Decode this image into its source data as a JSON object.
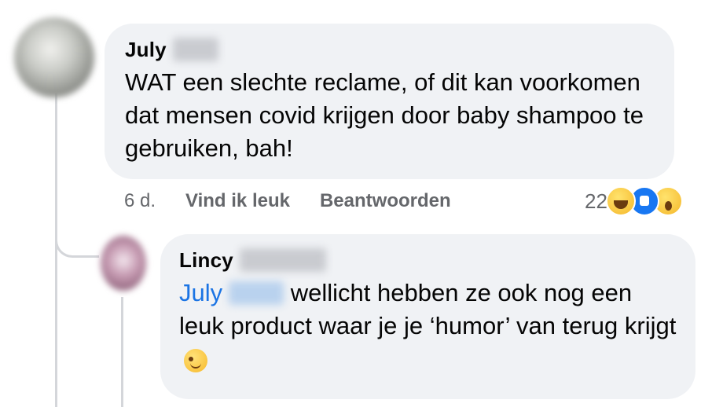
{
  "comment": {
    "author": "July",
    "text": "WAT een slechte reclame, of dit kan voorkomen dat mensen covid krijgen door baby shampoo te gebruiken, bah!",
    "time": "6 d.",
    "like_label": "Vind ik leuk",
    "reply_label": "Beantwoorden",
    "reaction_count": "22",
    "reactions": [
      "haha-icon",
      "like-icon",
      "wow-icon"
    ]
  },
  "reply": {
    "author": "Lincy",
    "mention": "July",
    "text": "wellicht hebben ze ook nog een leuk product waar je je ‘humor’ van terug krijgt",
    "emoji": "winking-face-icon"
  },
  "colors": {
    "bubble": "#f0f2f5",
    "mention": "#1b74e4",
    "meta_text": "#65676b",
    "like_blue": "#1877f2"
  }
}
